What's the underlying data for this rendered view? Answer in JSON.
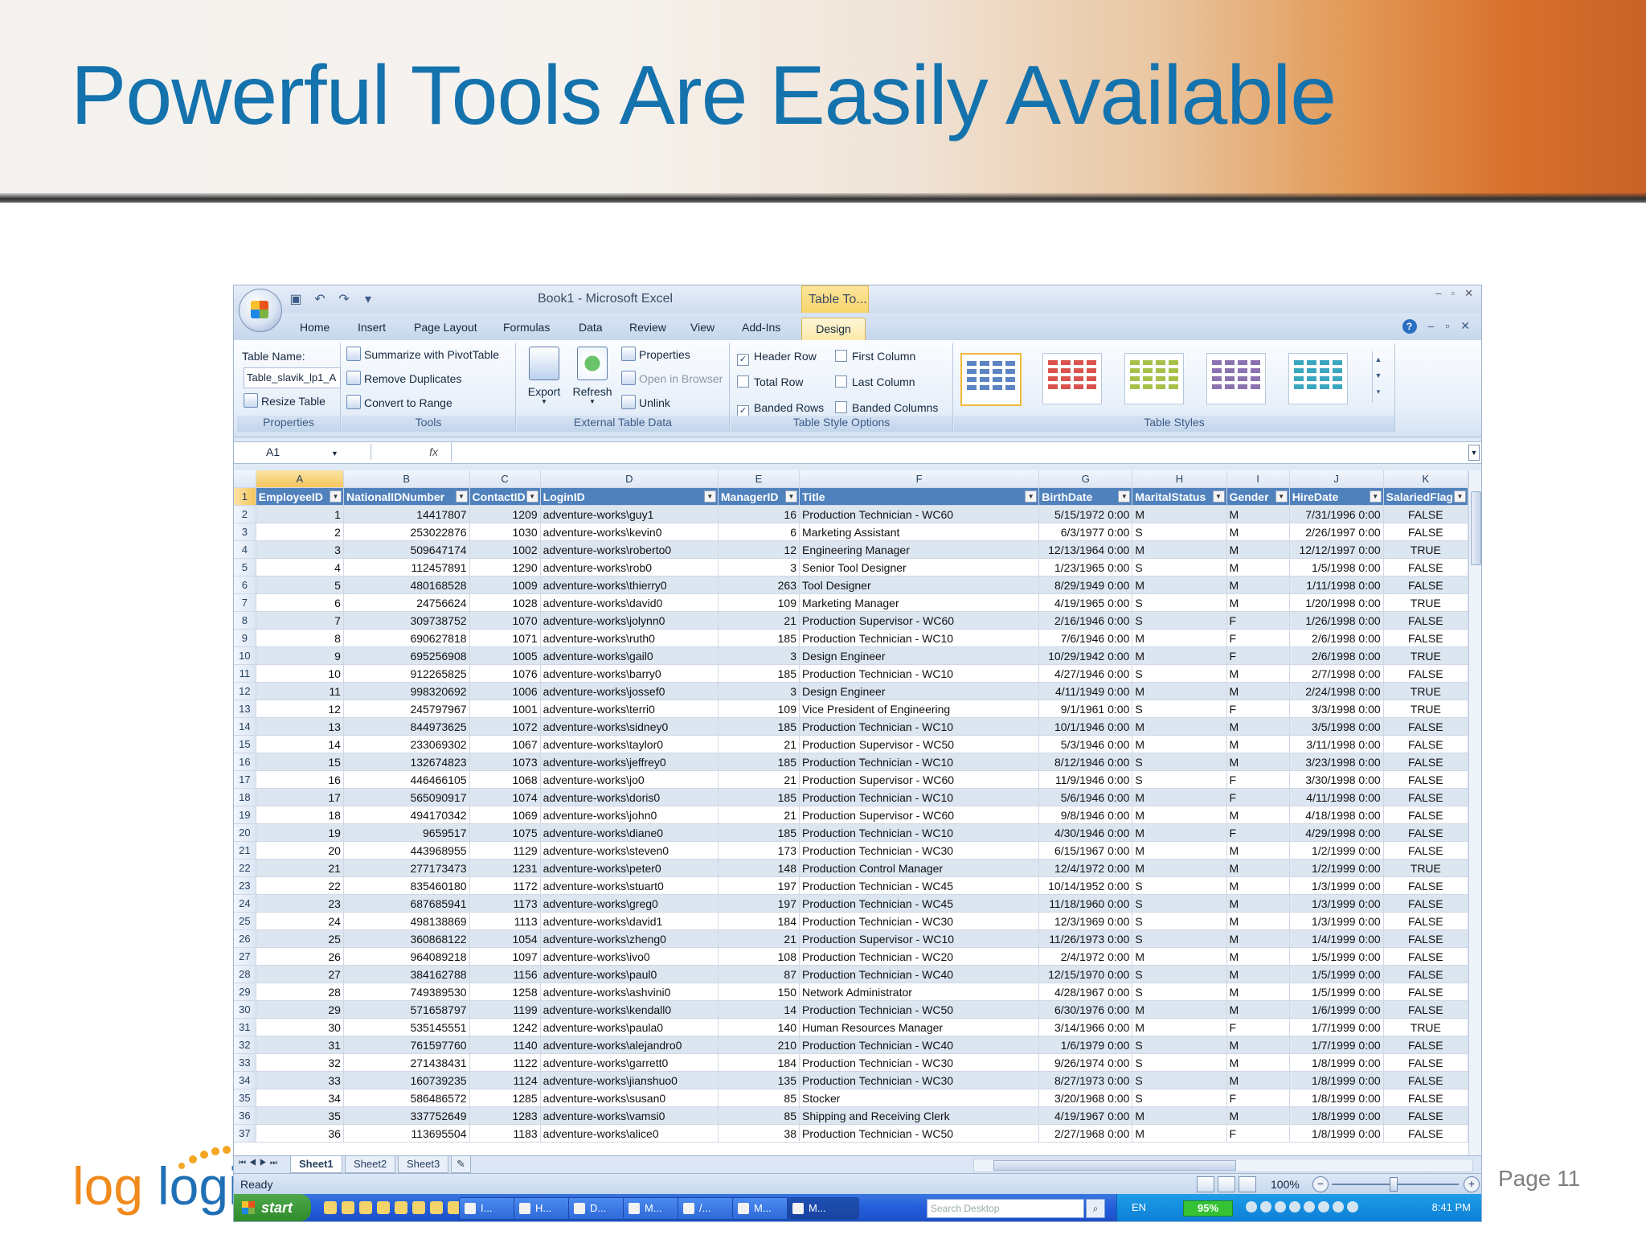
{
  "slide": {
    "title": "Powerful Tools Are Easily Available",
    "page_label": "Page 11",
    "logo_text": "loglogi"
  },
  "excel": {
    "window_title": "Book1 - Microsoft Excel",
    "context_tab": "Table To...",
    "window_controls": [
      "–",
      "▫",
      "✕"
    ],
    "tabs": [
      "Home",
      "Insert",
      "Page Layout",
      "Formulas",
      "Data",
      "Review",
      "View",
      "Add-Ins",
      "Design"
    ],
    "active_tab": "Design",
    "ribbon": {
      "properties": {
        "table_name_label": "Table Name:",
        "table_name_value": "Table_slavik_lp1_A",
        "resize_table": "Resize Table",
        "group_label": "Properties"
      },
      "tools": {
        "summarize": "Summarize with PivotTable",
        "remove_duplicates": "Remove Duplicates",
        "convert_to_range": "Convert to Range",
        "group_label": "Tools"
      },
      "external": {
        "export": "Export",
        "refresh": "Refresh",
        "properties": "Properties",
        "open_in_browser": "Open in Browser",
        "unlink": "Unlink",
        "group_label": "External Table Data"
      },
      "style_options": {
        "header_row": "Header Row",
        "total_row": "Total Row",
        "banded_rows": "Banded Rows",
        "first_column": "First Column",
        "last_column": "Last Column",
        "banded_columns": "Banded Columns",
        "header_row_checked": "✓",
        "total_row_checked": "",
        "banded_rows_checked": "✓",
        "first_column_checked": "",
        "last_column_checked": "",
        "banded_columns_checked": "",
        "group_label": "Table Style Options"
      },
      "styles": {
        "group_label": "Table Styles",
        "swatch_colors": [
          "#5b84c4",
          "#d9534f",
          "#a7c04a",
          "#8c72b0",
          "#3aa6c0"
        ]
      }
    },
    "formula_bar": {
      "name_box": "A1",
      "fx": "fx",
      "value": ""
    },
    "columns": [
      "A",
      "B",
      "C",
      "D",
      "E",
      "F",
      "G",
      "H",
      "I",
      "J",
      "K"
    ],
    "headers": [
      "EmployeeID",
      "NationalIDNumber",
      "ContactID",
      "LoginID",
      "ManagerID",
      "Title",
      "BirthDate",
      "MaritalStatus",
      "Gender",
      "HireDate",
      "SalariedFlag"
    ],
    "rows": [
      [
        "1",
        "14417807",
        "1209",
        "adventure-works\\guy1",
        "16",
        "Production Technician - WC60",
        "5/15/1972 0:00",
        "M",
        "M",
        "7/31/1996 0:00",
        "FALSE"
      ],
      [
        "2",
        "253022876",
        "1030",
        "adventure-works\\kevin0",
        "6",
        "Marketing Assistant",
        "6/3/1977 0:00",
        "S",
        "M",
        "2/26/1997 0:00",
        "FALSE"
      ],
      [
        "3",
        "509647174",
        "1002",
        "adventure-works\\roberto0",
        "12",
        "Engineering Manager",
        "12/13/1964 0:00",
        "M",
        "M",
        "12/12/1997 0:00",
        "TRUE"
      ],
      [
        "4",
        "112457891",
        "1290",
        "adventure-works\\rob0",
        "3",
        "Senior Tool Designer",
        "1/23/1965 0:00",
        "S",
        "M",
        "1/5/1998 0:00",
        "FALSE"
      ],
      [
        "5",
        "480168528",
        "1009",
        "adventure-works\\thierry0",
        "263",
        "Tool Designer",
        "8/29/1949 0:00",
        "M",
        "M",
        "1/11/1998 0:00",
        "FALSE"
      ],
      [
        "6",
        "24756624",
        "1028",
        "adventure-works\\david0",
        "109",
        "Marketing Manager",
        "4/19/1965 0:00",
        "S",
        "M",
        "1/20/1998 0:00",
        "TRUE"
      ],
      [
        "7",
        "309738752",
        "1070",
        "adventure-works\\jolynn0",
        "21",
        "Production Supervisor - WC60",
        "2/16/1946 0:00",
        "S",
        "F",
        "1/26/1998 0:00",
        "FALSE"
      ],
      [
        "8",
        "690627818",
        "1071",
        "adventure-works\\ruth0",
        "185",
        "Production Technician - WC10",
        "7/6/1946 0:00",
        "M",
        "F",
        "2/6/1998 0:00",
        "FALSE"
      ],
      [
        "9",
        "695256908",
        "1005",
        "adventure-works\\gail0",
        "3",
        "Design Engineer",
        "10/29/1942 0:00",
        "M",
        "F",
        "2/6/1998 0:00",
        "TRUE"
      ],
      [
        "10",
        "912265825",
        "1076",
        "adventure-works\\barry0",
        "185",
        "Production Technician - WC10",
        "4/27/1946 0:00",
        "S",
        "M",
        "2/7/1998 0:00",
        "FALSE"
      ],
      [
        "11",
        "998320692",
        "1006",
        "adventure-works\\jossef0",
        "3",
        "Design Engineer",
        "4/11/1949 0:00",
        "M",
        "M",
        "2/24/1998 0:00",
        "TRUE"
      ],
      [
        "12",
        "245797967",
        "1001",
        "adventure-works\\terri0",
        "109",
        "Vice President of Engineering",
        "9/1/1961 0:00",
        "S",
        "F",
        "3/3/1998 0:00",
        "TRUE"
      ],
      [
        "13",
        "844973625",
        "1072",
        "adventure-works\\sidney0",
        "185",
        "Production Technician - WC10",
        "10/1/1946 0:00",
        "M",
        "M",
        "3/5/1998 0:00",
        "FALSE"
      ],
      [
        "14",
        "233069302",
        "1067",
        "adventure-works\\taylor0",
        "21",
        "Production Supervisor - WC50",
        "5/3/1946 0:00",
        "M",
        "M",
        "3/11/1998 0:00",
        "FALSE"
      ],
      [
        "15",
        "132674823",
        "1073",
        "adventure-works\\jeffrey0",
        "185",
        "Production Technician - WC10",
        "8/12/1946 0:00",
        "S",
        "M",
        "3/23/1998 0:00",
        "FALSE"
      ],
      [
        "16",
        "446466105",
        "1068",
        "adventure-works\\jo0",
        "21",
        "Production Supervisor - WC60",
        "11/9/1946 0:00",
        "S",
        "F",
        "3/30/1998 0:00",
        "FALSE"
      ],
      [
        "17",
        "565090917",
        "1074",
        "adventure-works\\doris0",
        "185",
        "Production Technician - WC10",
        "5/6/1946 0:00",
        "M",
        "F",
        "4/11/1998 0:00",
        "FALSE"
      ],
      [
        "18",
        "494170342",
        "1069",
        "adventure-works\\john0",
        "21",
        "Production Supervisor - WC60",
        "9/8/1946 0:00",
        "M",
        "M",
        "4/18/1998 0:00",
        "FALSE"
      ],
      [
        "19",
        "9659517",
        "1075",
        "adventure-works\\diane0",
        "185",
        "Production Technician - WC10",
        "4/30/1946 0:00",
        "M",
        "F",
        "4/29/1998 0:00",
        "FALSE"
      ],
      [
        "20",
        "443968955",
        "1129",
        "adventure-works\\steven0",
        "173",
        "Production Technician - WC30",
        "6/15/1967 0:00",
        "M",
        "M",
        "1/2/1999 0:00",
        "FALSE"
      ],
      [
        "21",
        "277173473",
        "1231",
        "adventure-works\\peter0",
        "148",
        "Production Control Manager",
        "12/4/1972 0:00",
        "M",
        "M",
        "1/2/1999 0:00",
        "TRUE"
      ],
      [
        "22",
        "835460180",
        "1172",
        "adventure-works\\stuart0",
        "197",
        "Production Technician - WC45",
        "10/14/1952 0:00",
        "S",
        "M",
        "1/3/1999 0:00",
        "FALSE"
      ],
      [
        "23",
        "687685941",
        "1173",
        "adventure-works\\greg0",
        "197",
        "Production Technician - WC45",
        "11/18/1960 0:00",
        "S",
        "M",
        "1/3/1999 0:00",
        "FALSE"
      ],
      [
        "24",
        "498138869",
        "1113",
        "adventure-works\\david1",
        "184",
        "Production Technician - WC30",
        "12/3/1969 0:00",
        "S",
        "M",
        "1/3/1999 0:00",
        "FALSE"
      ],
      [
        "25",
        "360868122",
        "1054",
        "adventure-works\\zheng0",
        "21",
        "Production Supervisor - WC10",
        "11/26/1973 0:00",
        "S",
        "M",
        "1/4/1999 0:00",
        "FALSE"
      ],
      [
        "26",
        "964089218",
        "1097",
        "adventure-works\\ivo0",
        "108",
        "Production Technician - WC20",
        "2/4/1972 0:00",
        "M",
        "M",
        "1/5/1999 0:00",
        "FALSE"
      ],
      [
        "27",
        "384162788",
        "1156",
        "adventure-works\\paul0",
        "87",
        "Production Technician - WC40",
        "12/15/1970 0:00",
        "S",
        "M",
        "1/5/1999 0:00",
        "FALSE"
      ],
      [
        "28",
        "749389530",
        "1258",
        "adventure-works\\ashvini0",
        "150",
        "Network Administrator",
        "4/28/1967 0:00",
        "S",
        "M",
        "1/5/1999 0:00",
        "FALSE"
      ],
      [
        "29",
        "571658797",
        "1199",
        "adventure-works\\kendall0",
        "14",
        "Production Technician - WC50",
        "6/30/1976 0:00",
        "M",
        "M",
        "1/6/1999 0:00",
        "FALSE"
      ],
      [
        "30",
        "535145551",
        "1242",
        "adventure-works\\paula0",
        "140",
        "Human Resources Manager",
        "3/14/1966 0:00",
        "M",
        "F",
        "1/7/1999 0:00",
        "TRUE"
      ],
      [
        "31",
        "761597760",
        "1140",
        "adventure-works\\alejandro0",
        "210",
        "Production Technician - WC40",
        "1/6/1979 0:00",
        "S",
        "M",
        "1/7/1999 0:00",
        "FALSE"
      ],
      [
        "32",
        "271438431",
        "1122",
        "adventure-works\\garrett0",
        "184",
        "Production Technician - WC30",
        "9/26/1974 0:00",
        "S",
        "M",
        "1/8/1999 0:00",
        "FALSE"
      ],
      [
        "33",
        "160739235",
        "1124",
        "adventure-works\\jianshuo0",
        "135",
        "Production Technician - WC30",
        "8/27/1973 0:00",
        "S",
        "M",
        "1/8/1999 0:00",
        "FALSE"
      ],
      [
        "34",
        "586486572",
        "1285",
        "adventure-works\\susan0",
        "85",
        "Stocker",
        "3/20/1968 0:00",
        "S",
        "F",
        "1/8/1999 0:00",
        "FALSE"
      ],
      [
        "35",
        "337752649",
        "1283",
        "adventure-works\\vamsi0",
        "85",
        "Shipping and Receiving Clerk",
        "4/19/1967 0:00",
        "M",
        "M",
        "1/8/1999 0:00",
        "FALSE"
      ],
      [
        "36",
        "113695504",
        "1183",
        "adventure-works\\alice0",
        "38",
        "Production Technician - WC50",
        "2/27/1968 0:00",
        "M",
        "F",
        "1/8/1999 0:00",
        "FALSE"
      ]
    ],
    "sheet_tabs": [
      "Sheet1",
      "Sheet2",
      "Sheet3"
    ],
    "active_sheet": "Sheet1",
    "status": "Ready",
    "zoom": "100%"
  },
  "taskbar": {
    "start": "start",
    "buttons": [
      "I...",
      "H...",
      "D...",
      "M...",
      "/...",
      "M...",
      "M..."
    ],
    "search_placeholder": "Search Desktop",
    "language": "EN",
    "battery": "95%",
    "clock": "8:41 PM"
  }
}
